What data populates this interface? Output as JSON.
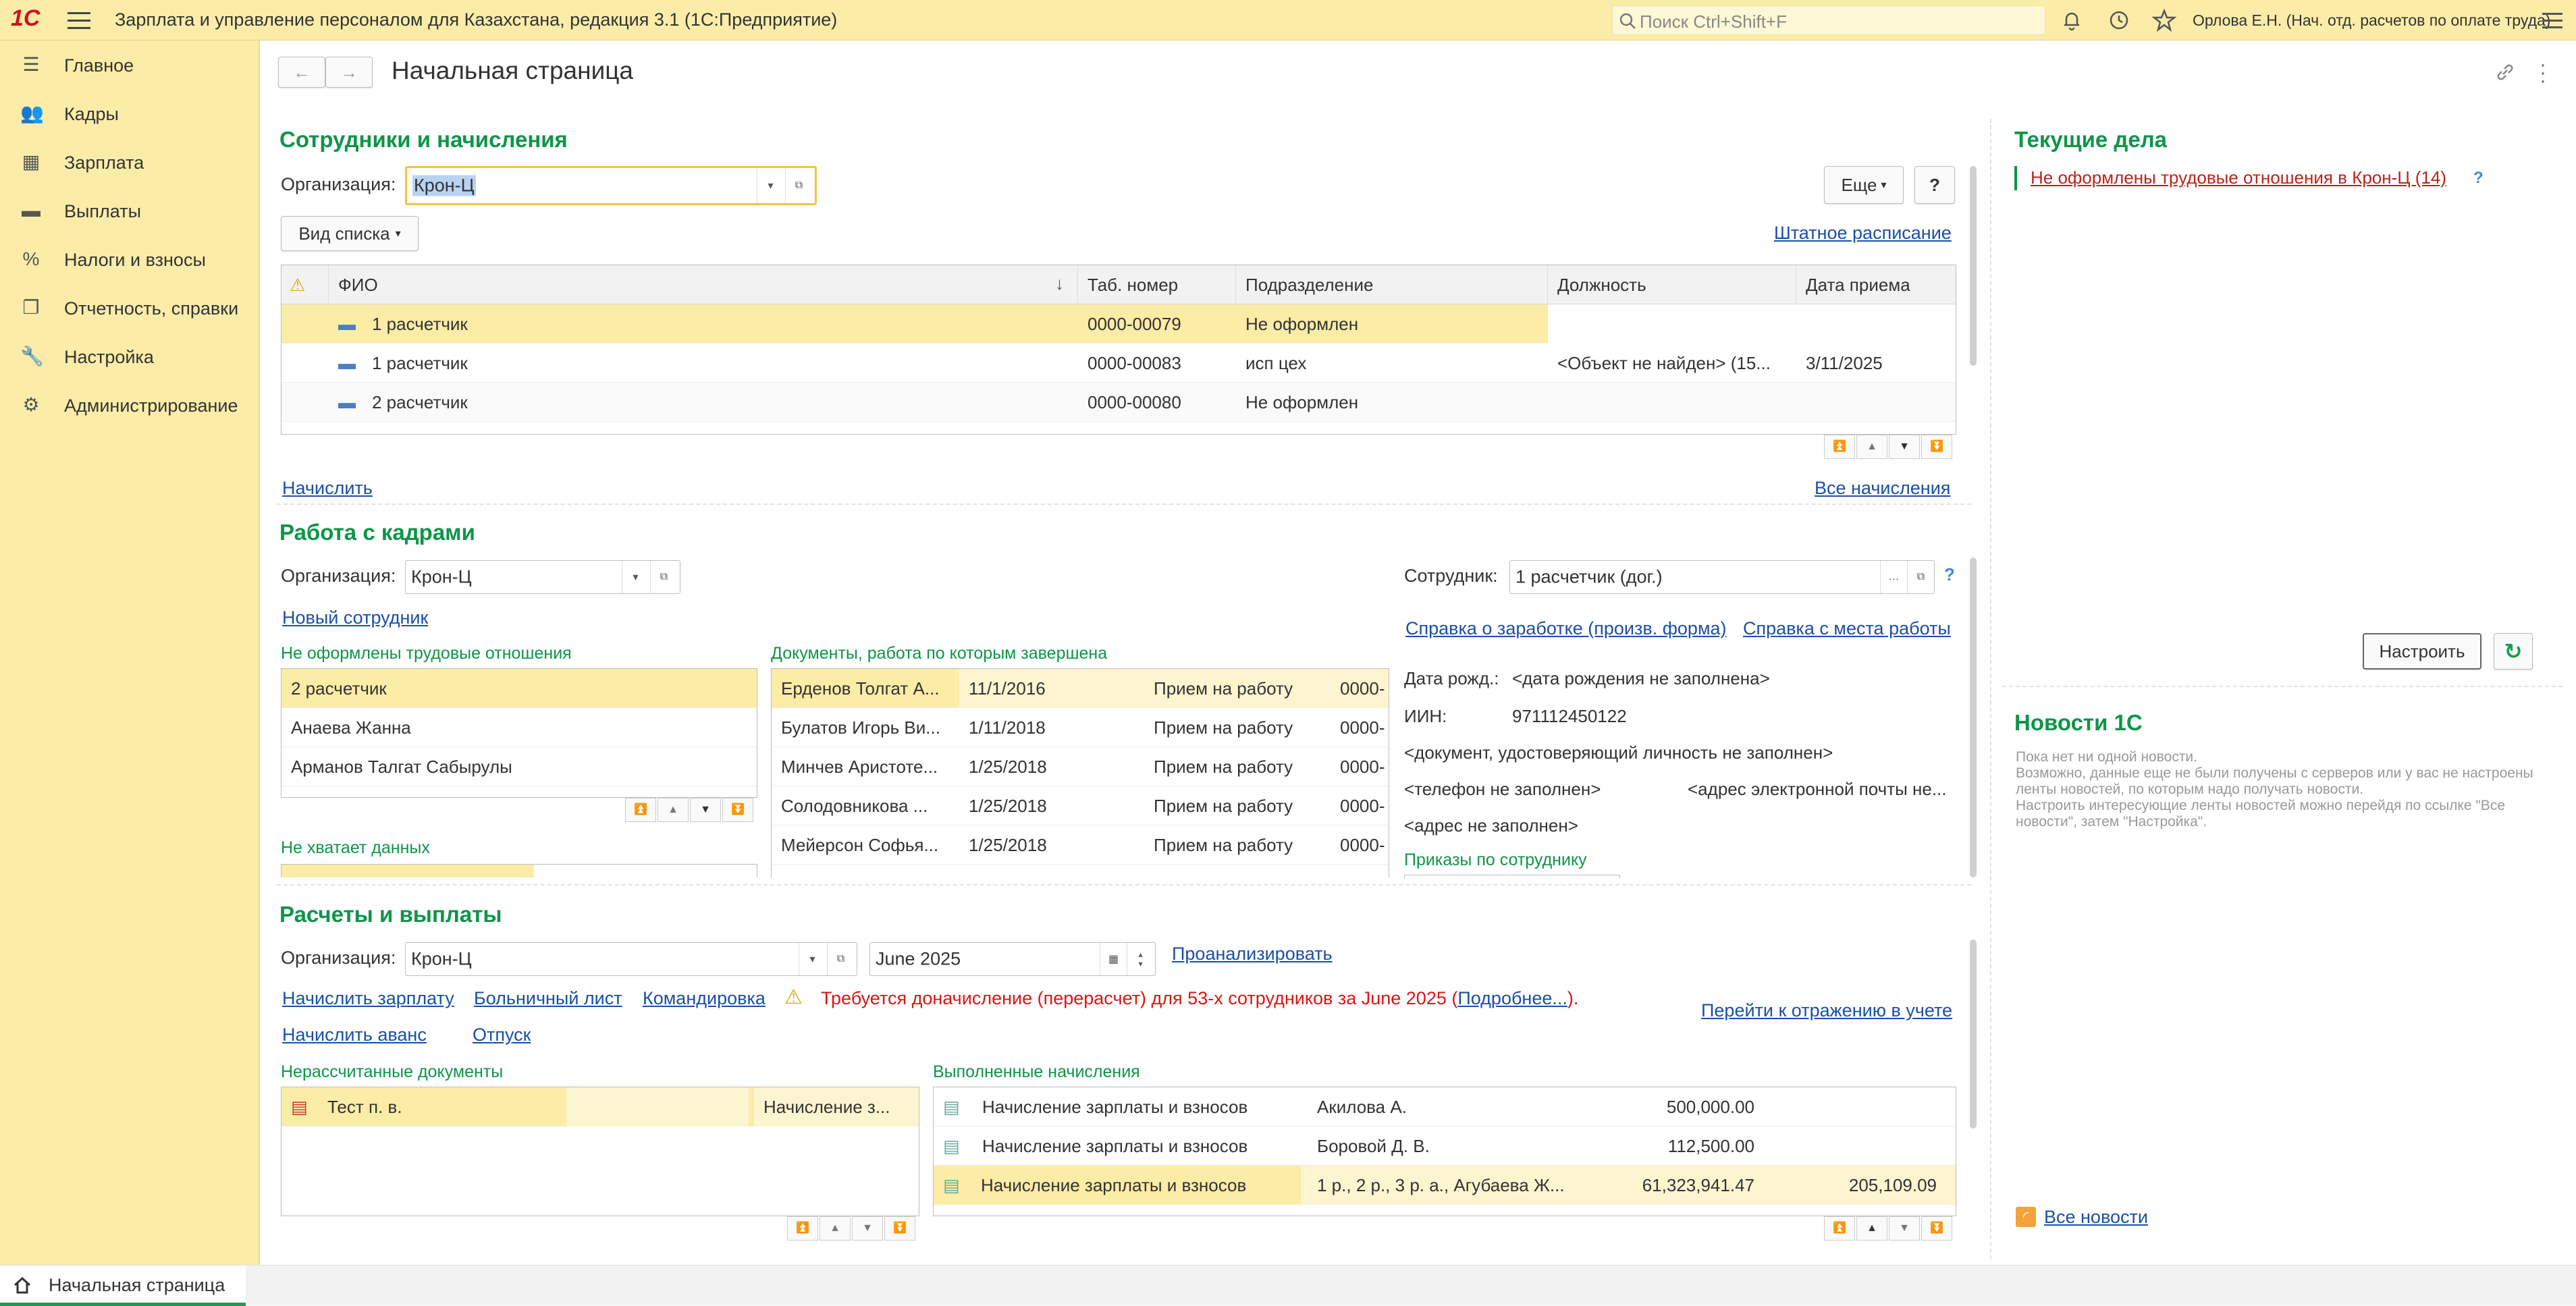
{
  "app": {
    "logo": "1С",
    "title": "Зарплата и управление персоналом для Казахстана, редакция 3.1  (1С:Предприятие)",
    "search_placeholder": "Поиск Ctrl+Shift+F",
    "user": "Орлова Е.Н. (Нач. отд. расчетов по оплате труда)"
  },
  "sidebar": {
    "items": [
      {
        "label": "Главное",
        "icon": "menu-lines-icon"
      },
      {
        "label": "Кадры",
        "icon": "people-icon"
      },
      {
        "label": "Зарплата",
        "icon": "calculator-icon"
      },
      {
        "label": "Выплаты",
        "icon": "wallet-icon"
      },
      {
        "label": "Налоги и взносы",
        "icon": "percent-icon"
      },
      {
        "label": "Отчетность, справки",
        "icon": "documents-icon"
      },
      {
        "label": "Настройка",
        "icon": "wrench-icon"
      },
      {
        "label": "Администрирование",
        "icon": "gear-icon"
      }
    ]
  },
  "page": {
    "title": "Начальная страница",
    "back": "←",
    "forward": "→"
  },
  "employees": {
    "heading": "Сотрудники и начисления",
    "org_label": "Организация:",
    "org_value": "Крон-Ц",
    "more_button": "Еще",
    "help_button": "?",
    "list_view_button": "Вид списка",
    "staffing_link": "Штатное расписание",
    "columns": [
      "ФИО",
      "Таб. номер",
      "Подразделение",
      "Должность",
      "Дата приема"
    ],
    "rows": [
      {
        "fio": "1 расчетчик",
        "tab": "0000-00079",
        "dept": "Не оформлен",
        "pos": "",
        "date": ""
      },
      {
        "fio": "1 расчетчик",
        "tab": "0000-00083",
        "dept": "исп цех",
        "pos": "<Объект не найден> (15...",
        "date": "3/11/2025"
      },
      {
        "fio": "2 расчетчик",
        "tab": "0000-00080",
        "dept": "Не оформлен",
        "pos": "",
        "date": ""
      }
    ],
    "accrue_link": "Начислить",
    "all_accruals_link": "Все начисления"
  },
  "hr": {
    "heading": "Работа с кадрами",
    "org_label": "Организация:",
    "org_value": "Крон-Ц",
    "new_employee_link": "Новый сотрудник",
    "unformalized_label": "Не оформлены трудовые отношения",
    "unformalized": [
      "2 расчетчик",
      "Анаева Жанна",
      "Арманов Талгат Сабырулы"
    ],
    "missing_label": "Не хватает данных",
    "docs_label": "Документы, работа по которым завершена",
    "docs": [
      {
        "name": "Ерденов Толгат А...",
        "date": "11/1/2016",
        "type": "Прием на работу",
        "num": "0000-"
      },
      {
        "name": "Булатов Игорь Ви...",
        "date": "1/11/2018",
        "type": "Прием на работу",
        "num": "0000-"
      },
      {
        "name": "Минчев Аристоте...",
        "date": "1/25/2018",
        "type": "Прием на работу",
        "num": "0000-"
      },
      {
        "name": "Солодовникова ...",
        "date": "1/25/2018",
        "type": "Прием на работу",
        "num": "0000-"
      },
      {
        "name": "Мейерсон Софья...",
        "date": "1/25/2018",
        "type": "Прием на работу",
        "num": "0000-"
      }
    ],
    "employee_label": "Сотрудник:",
    "employee_value": "1 расчетчик (дог.)",
    "salary_cert_link": "Справка о заработке (произв. форма)",
    "work_cert_link": "Справка с места работы",
    "birth_label": "Дата рожд.:",
    "birth_value": "<дата рождения не заполнена>",
    "iin_label": "ИИН:",
    "iin_value": "971112450122",
    "id_doc": "<документ, удостоверяющий личность не заполнен>",
    "phone": "<телефон не заполнен>",
    "email": "<адрес электронной почты не...",
    "address": "<адрес не заполнен>",
    "orders_label": "Приказы по сотруднику"
  },
  "payroll": {
    "heading": "Расчеты и выплаты",
    "org_label": "Организация:",
    "org_value": "Крон-Ц",
    "period": "June 2025",
    "analyze_link": "Проанализировать",
    "links": [
      "Начислить зарплату",
      "Больничный лист",
      "Командировка"
    ],
    "warning_text": "Требуется доначисление (перерасчет) для 53-х сотрудников за June 2025 (",
    "warning_more": "Подробнее...",
    "warning_end": ").",
    "advance_link": "Начислить аванс",
    "vacation_link": "Отпуск",
    "reflect_link": "Перейти к отражению в учете",
    "unsettled_label": "Нерассчитанные документы",
    "unsettled": [
      {
        "name": "Тест п. в.",
        "type": "Начисление з..."
      }
    ],
    "done_label": "Выполненные начисления",
    "done": [
      {
        "doc": "Начисление зарплаты и взносов",
        "who": "Акилова А.",
        "amount": "500,000.00",
        "extra": ""
      },
      {
        "doc": "Начисление зарплаты и взносов",
        "who": "Боровой Д. В.",
        "amount": "112,500.00",
        "extra": ""
      },
      {
        "doc": "Начисление зарплаты и взносов",
        "who": "1 р., 2 р., 3 р. а., Агубаева Ж...",
        "amount": "61,323,941.47",
        "extra": "205,109.09"
      }
    ]
  },
  "current": {
    "heading": "Текущие дела",
    "item": "Не оформлены трудовые отношения в Крон-Ц (14)",
    "help": "?",
    "configure_button": "Настроить"
  },
  "news": {
    "heading": "Новости 1С",
    "text": "Пока нет ни одной новости.\nВозможно, данные еще не были получены с серверов или у вас не настроены ленты новостей, по которым надо получать новости.\nНастроить интересующие ленты новостей можно перейдя по ссылке \"Все новости\", затем \"Настройка\".",
    "all_news_link": "Все новости"
  },
  "tabs": {
    "home": "Начальная страница"
  },
  "colors": {
    "accent_yellow": "#fbeda8",
    "heading_green": "#0e9548",
    "error_red": "#e01313",
    "link_blue": "#1a4fa8"
  }
}
